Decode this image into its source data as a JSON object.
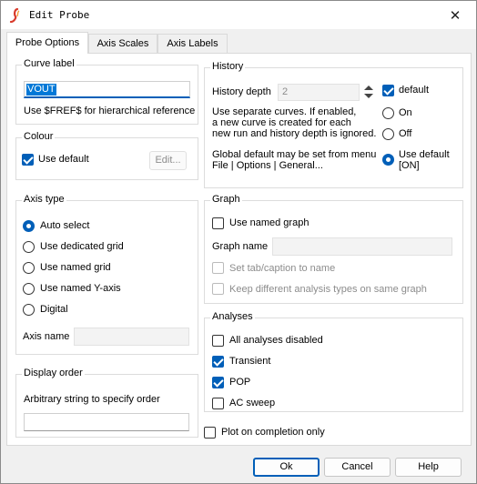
{
  "window": {
    "title": "Edit Probe"
  },
  "tabs": [
    "Probe Options",
    "Axis Scales",
    "Axis Labels"
  ],
  "curve_label": {
    "title": "Curve label",
    "value": "VOUT",
    "hint": "Use $FREF$ for hierarchical reference"
  },
  "colour": {
    "title": "Colour",
    "use_default": "Use default",
    "use_default_checked": true,
    "edit_button": "Edit..."
  },
  "axis_type": {
    "title": "Axis type",
    "options": [
      "Auto select",
      "Use dedicated grid",
      "Use named grid",
      "Use named Y-axis",
      "Digital"
    ],
    "selected": "Auto select",
    "axis_name_label": "Axis name",
    "axis_name_value": ""
  },
  "display_order": {
    "title": "Display order",
    "hint": "Arbitrary string to specify order",
    "value": ""
  },
  "history": {
    "title": "History",
    "depth_label": "History depth",
    "depth_value": "2",
    "default_label": "default",
    "default_checked": true,
    "separate_text": [
      "Use separate curves. If enabled,",
      "a new curve is created for each",
      "new run and history depth is ignored."
    ],
    "global_text": [
      "Global default may be set from menu",
      "File | Options | General..."
    ],
    "radio_options": [
      "On",
      "Off",
      "Use default",
      "[ON]"
    ],
    "radio_selected": "Use default"
  },
  "graph": {
    "title": "Graph",
    "use_named_graph": "Use named graph",
    "use_named_graph_checked": false,
    "graph_name_label": "Graph name",
    "graph_name_value": "",
    "set_tab": "Set tab/caption to name",
    "keep_different": "Keep different analysis types on same graph"
  },
  "analyses": {
    "title": "Analyses",
    "items": [
      {
        "label": "All analyses disabled",
        "checked": false
      },
      {
        "label": "Transient",
        "checked": true
      },
      {
        "label": "POP",
        "checked": true
      },
      {
        "label": "AC sweep",
        "checked": false
      }
    ]
  },
  "plot_on_completion": {
    "label": "Plot on completion only",
    "checked": false
  },
  "buttons": {
    "ok": "Ok",
    "cancel": "Cancel",
    "help": "Help"
  },
  "colors": {
    "accent": "#005fb8",
    "icon_red": "#d83a2a"
  }
}
